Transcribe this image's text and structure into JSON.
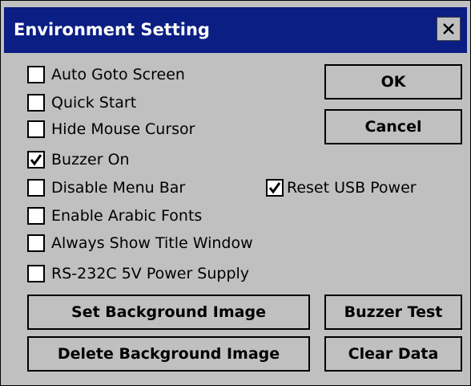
{
  "window": {
    "title": "Environment Setting",
    "close_glyph": "✕"
  },
  "checkboxes": [
    {
      "label": "Auto Goto Screen",
      "checked": false
    },
    {
      "label": "Quick Start",
      "checked": false
    },
    {
      "label": "Hide Mouse Cursor",
      "checked": false
    },
    {
      "label": "Buzzer On",
      "checked": true
    },
    {
      "label": "Disable Menu Bar",
      "checked": false
    },
    {
      "label": "Reset USB Power",
      "checked": true
    },
    {
      "label": "Enable Arabic Fonts",
      "checked": false
    },
    {
      "label": "Always Show Title Window",
      "checked": false
    },
    {
      "label": "RS-232C 5V Power Supply",
      "checked": false
    }
  ],
  "buttons": {
    "ok": "OK",
    "cancel": "Cancel",
    "set_bg": "Set Background Image",
    "delete_bg": "Delete Background Image",
    "buzzer_test": "Buzzer Test",
    "clear_data": "Clear Data"
  },
  "colors": {
    "titlebar": "#0a1e83",
    "dialog": "#c0c0c0",
    "title_text": "#ffffff"
  },
  "icons": {
    "close": "close-icon",
    "check": "checkmark-icon"
  }
}
